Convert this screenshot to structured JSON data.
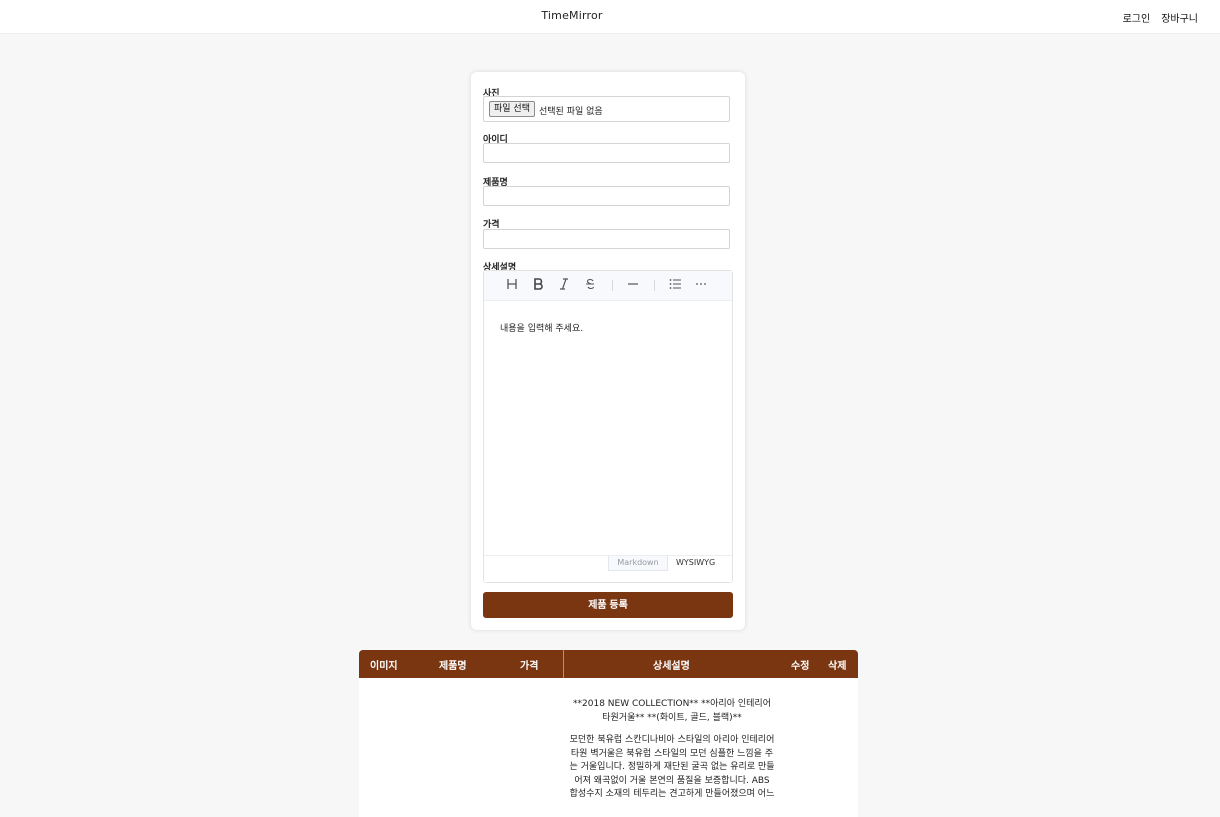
{
  "header": {
    "brand": "TimeMirror",
    "nav": [
      "로그인",
      "장바구니"
    ]
  },
  "form": {
    "photo_label": "사진",
    "file_button": "파일 선택",
    "file_status": "선택된 파일 없음",
    "id_label": "아이디",
    "id_value": "",
    "name_label": "제품명",
    "name_value": "",
    "price_label": "가격",
    "price_value": "",
    "detail_label": "상세설명",
    "editor": {
      "toolbar_icons": [
        "heading-icon",
        "bold-icon",
        "italic-icon",
        "strike-icon",
        "horizontal-rule-icon",
        "bullet-list-icon",
        "more-icon"
      ],
      "placeholder": "내용을 입력해 주세요.",
      "mode_markdown": "Markdown",
      "mode_wysiwyg": "WYSIWYG"
    },
    "submit_label": "제품 등록"
  },
  "table": {
    "headers": [
      "이미지",
      "제품명",
      "가격",
      "상세설명",
      "수정",
      "삭제"
    ],
    "rows": [
      {
        "description": [
          "**2018 NEW COLLECTION** **아리아 인테리어 타원거울** **(화이트, 골드, 블랙)**",
          "모던한 북유럽 스칸디나비아 스타일의 아리아 인테리어 타원 벽거울은 북유럽 스타일의 모던 심플한 느낌을 주는 거울입니다. 정밀하게 재단된 굴곡 없는 유리로 만들어져 왜곡없이 거울 본연의 품질을 보증합니다. ABS 합성수지 소재의 테두리는 견고하게 만들어졌으며 어느"
        ]
      }
    ]
  },
  "colors": {
    "accent": "#7a3511",
    "background": "#f7f7f7"
  }
}
